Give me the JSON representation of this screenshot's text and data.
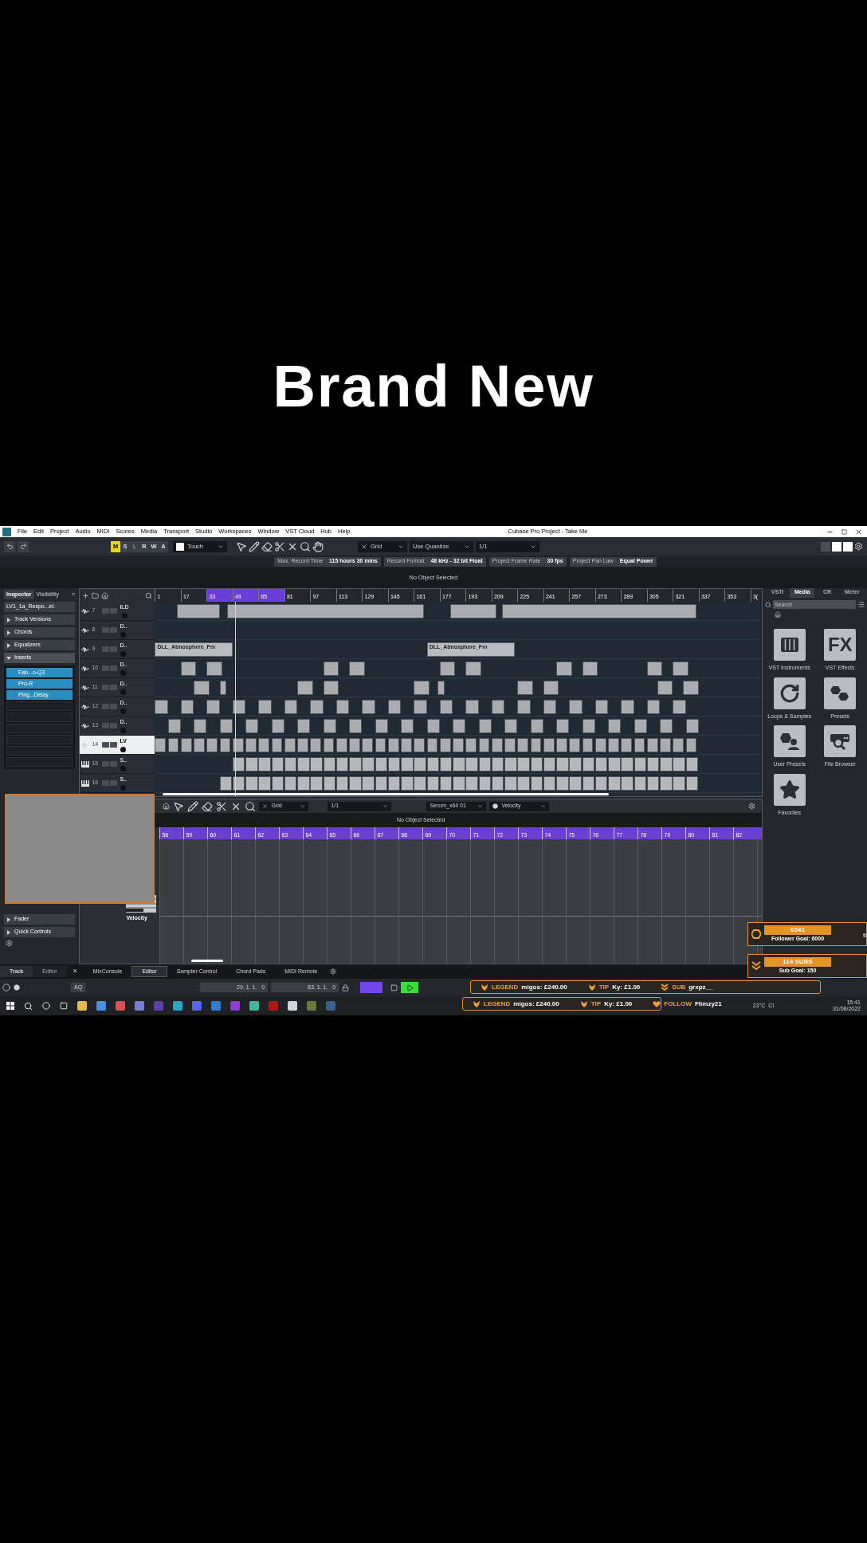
{
  "caption": "Brand New",
  "window": {
    "title": "Cubase Pro Project - Take Me",
    "menu": [
      "File",
      "Edit",
      "Project",
      "Audio",
      "MIDI",
      "Scores",
      "Media",
      "Transport",
      "Studio",
      "Workspaces",
      "Window",
      "VST Cloud",
      "Hub",
      "Help"
    ]
  },
  "toolbar": {
    "automation": [
      {
        "label": "M",
        "on": true,
        "disabled": false
      },
      {
        "label": "S",
        "on": false,
        "disabled": false
      },
      {
        "label": "L",
        "on": false,
        "disabled": true
      },
      {
        "label": "R",
        "on": false,
        "disabled": false
      },
      {
        "label": "W",
        "on": false,
        "disabled": false
      },
      {
        "label": "A",
        "on": false,
        "disabled": false
      }
    ],
    "automation_mode": "Touch",
    "snap_type": "Grid",
    "quantize_mode": "Use Quantize",
    "quantize_value": "1/1"
  },
  "status_line": [
    {
      "label": "Max. Record Time",
      "value": "115 hours 30 mins"
    },
    {
      "label": "Record Format",
      "value": "48 kHz - 32 bit Float"
    },
    {
      "label": "Project Frame Rate",
      "value": "30 fps"
    },
    {
      "label": "Project Pan Law",
      "value": "Equal Power"
    }
  ],
  "info_line": "No Object Selected",
  "inspector": {
    "tabs": [
      {
        "label": "Inspector",
        "selected": true
      },
      {
        "label": "Visibility",
        "selected": false
      }
    ],
    "menu_glyph": "=",
    "track_name": "LV1_1a_Respo...et",
    "sections": [
      {
        "label": "Track Versions",
        "expanded": false
      },
      {
        "label": "Chords",
        "expanded": false
      },
      {
        "label": "Equalizers",
        "expanded": false
      },
      {
        "label": "Inserts",
        "expanded": true
      }
    ],
    "inserts": [
      "Fab...o-Q3",
      "Pro-R",
      "Ping...Delay"
    ],
    "lower_sections": [
      {
        "label": "Fader",
        "expanded": false
      },
      {
        "label": "Quick Controls",
        "expanded": false
      }
    ]
  },
  "tracks": [
    {
      "number": "7",
      "name": "ILD",
      "kind": "audio",
      "selected": false
    },
    {
      "number": "8",
      "name": "D..",
      "kind": "audio",
      "selected": false
    },
    {
      "number": "9",
      "name": "D..",
      "kind": "audio",
      "selected": false,
      "events": [
        "DLL_Atmosphere_Fm",
        "DLL_Atmosphere_Fm"
      ]
    },
    {
      "number": "10",
      "name": "D..",
      "kind": "audio",
      "selected": false
    },
    {
      "number": "11",
      "name": "D..",
      "kind": "audio",
      "selected": false
    },
    {
      "number": "12",
      "name": "D..",
      "kind": "audio",
      "selected": false
    },
    {
      "number": "13",
      "name": "D..",
      "kind": "audio",
      "selected": false
    },
    {
      "number": "14",
      "name": "LV",
      "kind": "audio",
      "selected": true
    },
    {
      "number": "15",
      "name": "S..",
      "kind": "instrument",
      "selected": false
    },
    {
      "number": "16",
      "name": "S..",
      "kind": "instrument",
      "selected": false
    }
  ],
  "ruler": [
    {
      "label": "1",
      "in_cycle": false
    },
    {
      "label": "17",
      "in_cycle": false
    },
    {
      "label": "33",
      "in_cycle": true
    },
    {
      "label": "49",
      "in_cycle": true
    },
    {
      "label": "65",
      "in_cycle": true
    },
    {
      "label": "81",
      "in_cycle": false
    },
    {
      "label": "97",
      "in_cycle": false
    },
    {
      "label": "113",
      "in_cycle": false
    },
    {
      "label": "129",
      "in_cycle": false
    },
    {
      "label": "145",
      "in_cycle": false
    },
    {
      "label": "161",
      "in_cycle": false
    },
    {
      "label": "177",
      "in_cycle": false
    },
    {
      "label": "193",
      "in_cycle": false
    },
    {
      "label": "209",
      "in_cycle": false
    },
    {
      "label": "225",
      "in_cycle": false
    },
    {
      "label": "241",
      "in_cycle": false
    },
    {
      "label": "257",
      "in_cycle": false
    },
    {
      "label": "273",
      "in_cycle": false
    },
    {
      "label": "289",
      "in_cycle": false
    },
    {
      "label": "305",
      "in_cycle": false
    },
    {
      "label": "321",
      "in_cycle": false
    },
    {
      "label": "337",
      "in_cycle": false
    },
    {
      "label": "353",
      "in_cycle": false
    },
    {
      "label": "3(",
      "in_cycle": false
    }
  ],
  "media_panel": {
    "tabs": [
      {
        "label": "VSTi",
        "selected": false
      },
      {
        "label": "Media",
        "selected": true
      },
      {
        "label": "CR",
        "selected": false
      },
      {
        "label": "Meter",
        "selected": false
      }
    ],
    "search": {
      "placeholder": "Search"
    },
    "fx_glyph": "FX",
    "tiles": [
      {
        "label": "VST Instruments",
        "kind": "piano"
      },
      {
        "label": "VST Effects",
        "kind": "fx"
      },
      {
        "label": "Loops & Samples",
        "kind": "loop"
      },
      {
        "label": "Presets",
        "kind": "presets"
      },
      {
        "label": "User Presets",
        "kind": "user-presets"
      },
      {
        "label": "File Browser",
        "kind": "file-browser"
      },
      {
        "label": "Favorites",
        "kind": "favorites"
      }
    ]
  },
  "lower_zone": {
    "snap_type": "Grid",
    "quantize_value": "1/1",
    "instrument": "Serum_x64 01",
    "controller": "Velocity",
    "info": "No Object Selected",
    "ruler": [
      "58",
      "59",
      "60",
      "61",
      "62",
      "63",
      "64",
      "65",
      "66",
      "67",
      "68",
      "69",
      "70",
      "71",
      "72",
      "73",
      "74",
      "75",
      "76",
      "77",
      "78",
      "79",
      "80",
      "81",
      "82"
    ],
    "lane_label": "Velocity"
  },
  "bottom_tabs": {
    "left": [
      {
        "label": "Track",
        "selected": true
      },
      {
        "label": "Editor",
        "selected": false
      }
    ],
    "close_glyph": "×",
    "right": [
      {
        "label": "MixConsole",
        "selected": false
      },
      {
        "label": "Editor",
        "selected": true
      },
      {
        "label": "Sampler Control",
        "selected": false
      },
      {
        "label": "Chord Pads",
        "selected": false
      },
      {
        "label": "MIDI Remote",
        "selected": false
      }
    ]
  },
  "transport": {
    "aq": "AQ",
    "left_locator": "29. 1. 1.   0",
    "right_locator": "83. 1. 1.   0",
    "playing": true
  },
  "taskbar": {
    "weather": {
      "temperature": "23°C",
      "text": "Cl"
    },
    "clock": {
      "time": "15:41",
      "date": "31/08/2022"
    }
  },
  "stream_overlay": {
    "goals": [
      {
        "count": "6541",
        "caption": "Follower Goal: 6000",
        "kind": "follower"
      },
      {
        "count": "114 SUBS",
        "caption": "Sub Goal: 150",
        "kind": "subs"
      }
    ],
    "edge_text": "ti",
    "ticker_top": [
      {
        "kind": "legend",
        "label": "LEGEND",
        "text": "migos: £240.00"
      },
      {
        "kind": "tip",
        "label": "TIP",
        "text": "Ky: £1.00"
      },
      {
        "kind": "sub",
        "label": "SUB",
        "text": "grxpz__"
      }
    ],
    "ticker_bottom": [
      {
        "kind": "legend",
        "label": "LEGEND",
        "text": "migos: £240.00"
      },
      {
        "kind": "tip",
        "label": "TIP",
        "text": "Ky: £1.00"
      },
      {
        "kind": "follow",
        "label": "FOLLOW",
        "text": "Flimzy21"
      }
    ]
  }
}
